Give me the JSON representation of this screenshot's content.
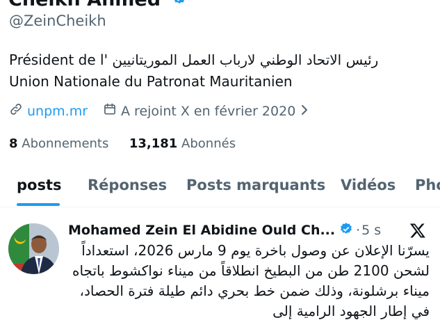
{
  "profile": {
    "name": "Cheikh Ahmed",
    "handle": "@ZeinCheikh",
    "bio_line1": "Président de l' رئيس الاتحاد الوطني لارباب العمل الموريتانيين",
    "bio_line2": "Union Nationale du Patronat Mauritanien",
    "website": "unpm.mr",
    "joined": "A rejoint X en février 2020",
    "following_count": "8",
    "following_label": "Abonnements",
    "followers_count": "13,181",
    "followers_label": "Abonnés"
  },
  "tabs": [
    {
      "label": "posts",
      "active": true
    },
    {
      "label": "Réponses",
      "active": false
    },
    {
      "label": "Posts marquants",
      "active": false
    },
    {
      "label": "Vidéos",
      "active": false
    },
    {
      "label": "Pho",
      "active": false
    }
  ],
  "post": {
    "author": "Mohamed Zein El Abidine Ould Ch...",
    "separator": "·",
    "time": "5 s",
    "text": "يسرّنا الإعلان عن وصول باخرة يوم 9 مارس 2026، استعداداً لشحن 2100 طن من البطيخ انطلاقاً من ميناء نواكشوط باتجاه ميناء برشلونة، وذلك ضمن خط بحري دائم طيلة فترة الحصاد، في إطار الجهود الرامية إلى"
  },
  "colors": {
    "accent": "#1d9bf0",
    "secondary_text": "#536471",
    "primary_text": "#0f1419"
  },
  "icons": [
    "verified-badge-icon",
    "link-icon",
    "calendar-icon",
    "chevron-right-icon",
    "x-logo-icon"
  ]
}
